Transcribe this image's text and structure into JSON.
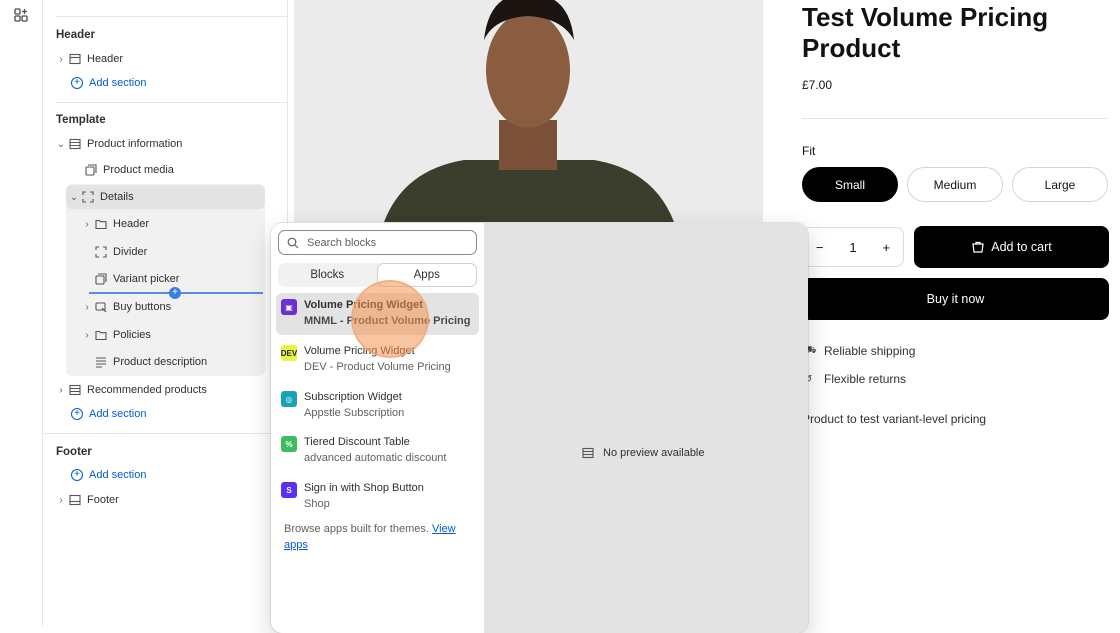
{
  "sidebar": {
    "header_group": "Header",
    "header_item": "Header",
    "add_section": "Add section",
    "template_group": "Template",
    "product_information": "Product information",
    "product_media": "Product media",
    "details": "Details",
    "details_children": [
      "Header",
      "Divider",
      "Variant picker",
      "Buy buttons",
      "Policies",
      "Product description"
    ],
    "recommended_products": "Recommended products",
    "footer_group": "Footer",
    "footer_item": "Footer"
  },
  "product": {
    "title": "Test Volume Pricing Product",
    "price": "£7.00",
    "fit_label": "Fit",
    "sizes": [
      "Small",
      "Medium",
      "Large"
    ],
    "quantity": "1",
    "add_to_cart": "Add to cart",
    "buy_now": "Buy it now",
    "features": [
      "Reliable shipping",
      "Flexible returns"
    ],
    "description": "Product to test variant-level pricing"
  },
  "popover": {
    "search_placeholder": "Search blocks",
    "tabs": [
      "Blocks",
      "Apps"
    ],
    "active_tab": "Apps",
    "apps": [
      {
        "name": "Volume Pricing Widget",
        "sub": "MNML - Product Volume Pricing",
        "logo_color": "#6b2fd6"
      },
      {
        "name": "Volume Pricing Widget",
        "sub": "DEV - Product Volume Pricing",
        "logo_color": "#e6f542"
      },
      {
        "name": "Subscription Widget",
        "sub": "Appstle Subscription",
        "logo_color": "#17a2b8"
      },
      {
        "name": "Tiered Discount Table",
        "sub": "advanced automatic discount",
        "logo_color": "#3dbb5e"
      },
      {
        "name": "Sign in with Shop Button",
        "sub": "Shop",
        "logo_color": "#5a31f4"
      }
    ],
    "browse_text": "Browse apps built for themes.",
    "browse_link": "View apps",
    "no_preview": "No preview available"
  },
  "colors": {
    "accent": "#005bd3",
    "drop_indicator": "#3d7de0",
    "cursor_highlight": "#f49654"
  }
}
